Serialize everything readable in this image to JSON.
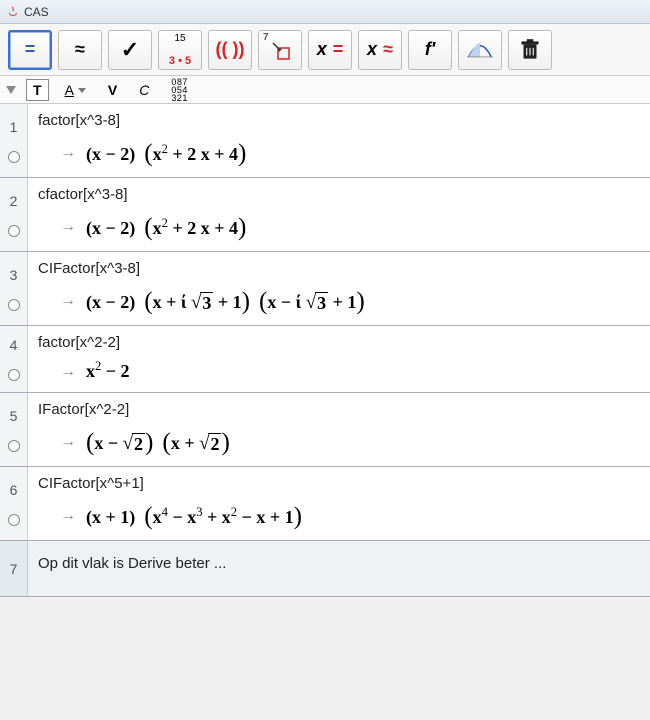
{
  "window": {
    "title": "CAS"
  },
  "toolbar": {
    "eval": "=",
    "approx": "≈",
    "keep": "✓",
    "factor_top": "15",
    "factor_bot": "3 • 5",
    "paren": "(( ))",
    "subst_corner": "7",
    "solve_x": "x",
    "solve_eq": "=",
    "nsolve_x": "x",
    "nsolve_approx": "≈",
    "deriv": "f′",
    "delete": ""
  },
  "stylebar": {
    "text": "T",
    "font": "A",
    "bold": "V",
    "italic": "C",
    "para": "¶"
  },
  "rows": [
    {
      "num": "1",
      "input": "factor[x^3-8]",
      "out_html": "<span class='b'>(x − 2)</span>&nbsp;&nbsp;<span class='paren-l'>(</span><span class='b'>x</span><sup>2</sup> <span class='b'>+ 2 x + 4</span><span class='paren-r'>)</span>"
    },
    {
      "num": "2",
      "input": "cfactor[x^3-8]",
      "out_html": "<span class='b'>(x − 2)</span>&nbsp;&nbsp;<span class='paren-l'>(</span><span class='b'>x</span><sup>2</sup> <span class='b'>+ 2 x + 4</span><span class='paren-r'>)</span>"
    },
    {
      "num": "3",
      "input": "CIFactor[x^3-8]",
      "out_html": "<span class='b'>(x − 2)</span>&nbsp;&nbsp;<span class='paren-l'>(</span><span class='b'>x + ί </span><span class='sqrt'><span class='rad'>√</span><span class='arg b'>3</span></span><span class='b'> + 1</span><span class='paren-r'>)</span>&nbsp;&nbsp;<span class='paren-l'>(</span><span class='b'>x − ί </span><span class='sqrt'><span class='rad'>√</span><span class='arg b'>3</span></span><span class='b'> + 1</span><span class='paren-r'>)</span>"
    },
    {
      "num": "4",
      "input": "factor[x^2-2]",
      "out_html": "<span class='b'>x</span><sup>2</sup> <span class='b'>− 2</span>"
    },
    {
      "num": "5",
      "input": "IFactor[x^2-2]",
      "out_html": "<span class='paren-l'>(</span><span class='b'>x − </span><span class='sqrt'><span class='rad'>√</span><span class='arg b'>2</span></span><span class='paren-r'>)</span>&nbsp;&nbsp;<span class='paren-l'>(</span><span class='b'>x + </span><span class='sqrt'><span class='rad'>√</span><span class='arg b'>2</span></span><span class='paren-r'>)</span>"
    },
    {
      "num": "6",
      "input": "CIFactor[x^5+1]",
      "out_html": "<span class='b'>(x + 1)</span>&nbsp;&nbsp;<span class='paren-l'>(</span><span class='b'>x</span><sup>4</sup> <span class='b'>− x</span><sup>3</sup> <span class='b'>+ x</span><sup>2</sup> <span class='b'>− x + 1</span><span class='paren-r'>)</span>"
    },
    {
      "num": "7",
      "input": "Op dit vlak is Derive beter ...",
      "out_html": null,
      "selected": true
    }
  ]
}
